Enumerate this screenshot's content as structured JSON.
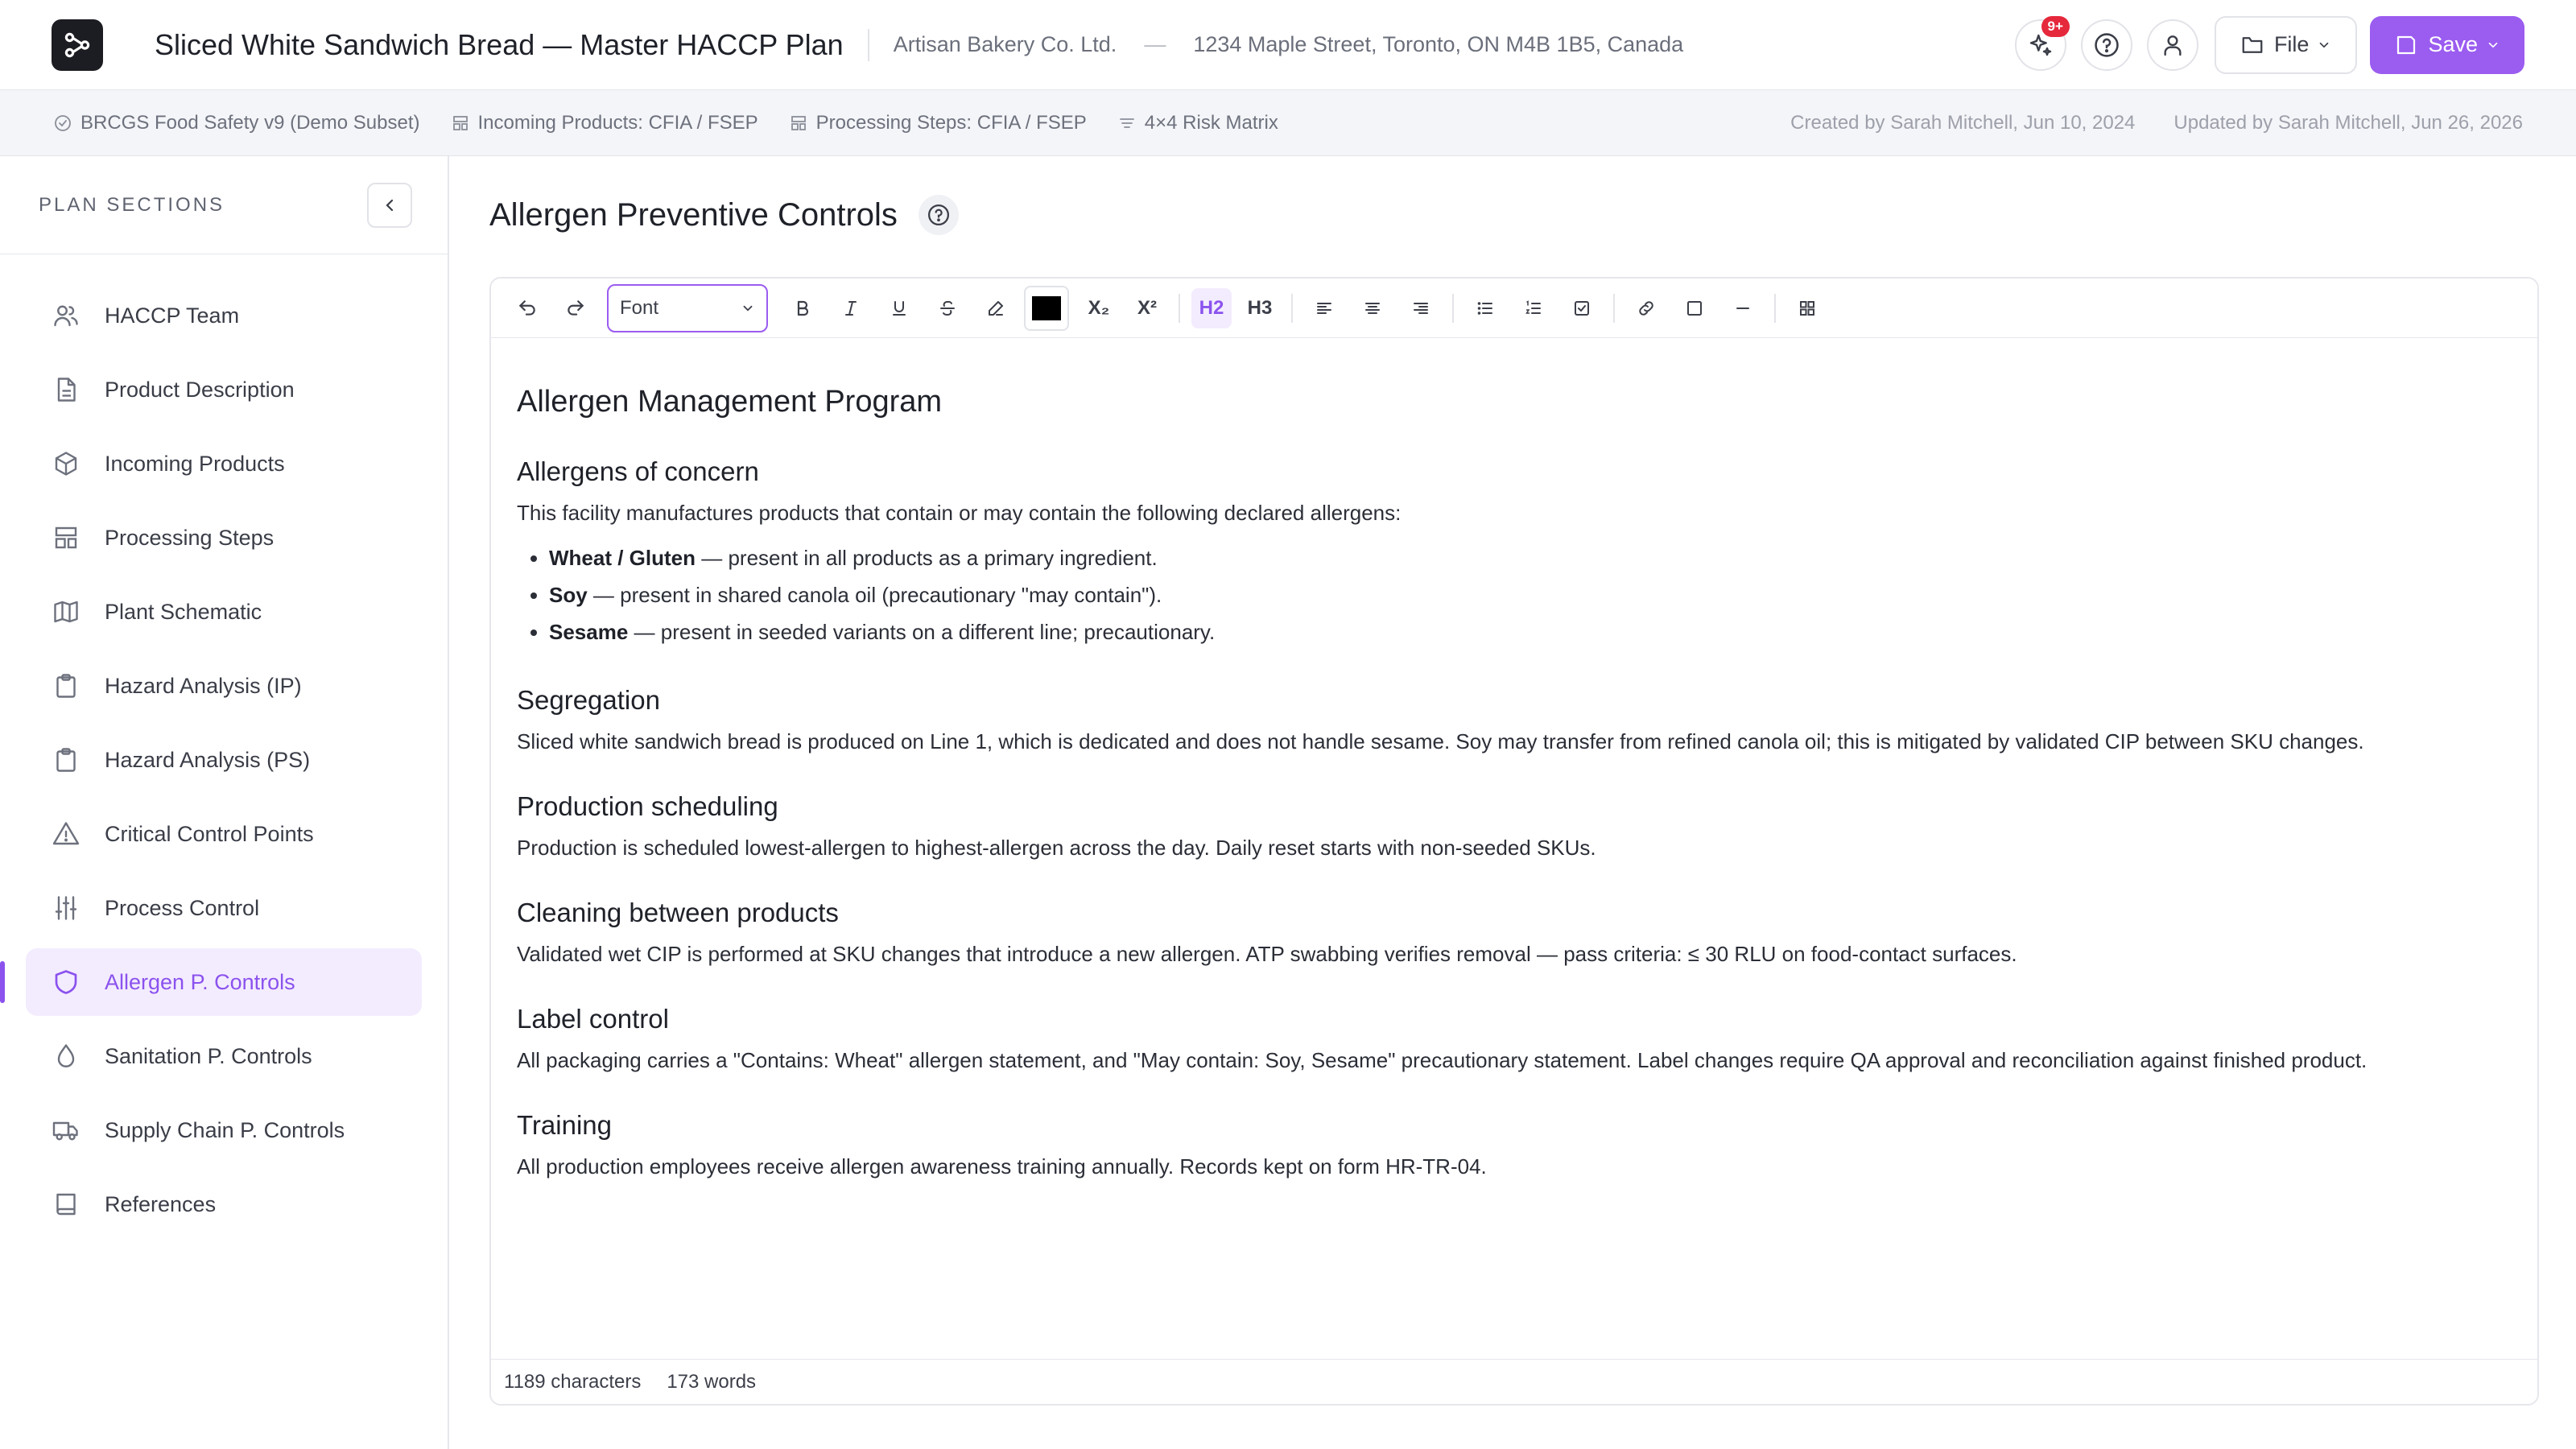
{
  "header": {
    "plan_title": "Sliced White Sandwich Bread — Master HACCP Plan",
    "company": "Artisan Bakery Co. Ltd.",
    "separator": "—",
    "address": "1234 Maple Street, Toronto, ON M4B 1B5, Canada",
    "notification_badge": "9+",
    "file_label": "File",
    "save_label": "Save",
    "accent_color": "#9b5cf0"
  },
  "meta": {
    "standard": "BRCGS Food Safety v9 (Demo Subset)",
    "incoming_products": "Incoming Products: CFIA / FSEP",
    "processing_steps": "Processing Steps: CFIA / FSEP",
    "risk_matrix": "4×4 Risk Matrix",
    "created": "Created by Sarah Mitchell, Jun 10, 2024",
    "updated": "Updated by Sarah Mitchell, Jun 26, 2026"
  },
  "sidebar": {
    "title": "PLAN SECTIONS",
    "items": [
      {
        "label": "HACCP Team",
        "icon": "users-icon"
      },
      {
        "label": "Product Description",
        "icon": "document-icon"
      },
      {
        "label": "Incoming Products",
        "icon": "box-icon"
      },
      {
        "label": "Processing Steps",
        "icon": "layout-icon"
      },
      {
        "label": "Plant Schematic",
        "icon": "map-icon"
      },
      {
        "label": "Hazard Analysis (IP)",
        "icon": "clipboard-icon"
      },
      {
        "label": "Hazard Analysis (PS)",
        "icon": "clipboard-icon"
      },
      {
        "label": "Critical Control Points",
        "icon": "warning-icon"
      },
      {
        "label": "Process Control",
        "icon": "sliders-icon"
      },
      {
        "label": "Allergen P. Controls",
        "icon": "shield-icon",
        "active": true
      },
      {
        "label": "Sanitation P. Controls",
        "icon": "droplet-icon"
      },
      {
        "label": "Supply Chain P. Controls",
        "icon": "truck-icon"
      },
      {
        "label": "References",
        "icon": "book-icon"
      }
    ]
  },
  "page": {
    "title": "Allergen Preventive Controls"
  },
  "toolbar": {
    "font_select": "Font",
    "subscript": "X₂",
    "superscript": "X²",
    "h2": "H2",
    "h3": "H3"
  },
  "document": {
    "title": "Allergen Management Program",
    "allergens_heading": "Allergens of concern",
    "allergens_intro": "This facility manufactures products that contain or may contain the following declared allergens:",
    "allergens": [
      {
        "name": "Wheat / Gluten",
        "text": " — present in all products as a primary ingredient."
      },
      {
        "name": "Soy",
        "text": " — present in shared canola oil (precautionary \"may contain\")."
      },
      {
        "name": "Sesame",
        "text": " — present in seeded variants on a different line; precautionary."
      }
    ],
    "segregation_heading": "Segregation",
    "segregation_text": "Sliced white sandwich bread is produced on Line 1, which is dedicated and does not handle sesame. Soy may transfer from refined canola oil; this is mitigated by validated CIP between SKU changes.",
    "scheduling_heading": "Production scheduling",
    "scheduling_text": "Production is scheduled lowest-allergen to highest-allergen across the day. Daily reset starts with non-seeded SKUs.",
    "cleaning_heading": "Cleaning between products",
    "cleaning_text": "Validated wet CIP is performed at SKU changes that introduce a new allergen. ATP swabbing verifies removal — pass criteria: ≤ 30 RLU on food-contact surfaces.",
    "label_heading": "Label control",
    "label_text": "All packaging carries a \"Contains: Wheat\" allergen statement, and \"May contain: Soy, Sesame\" precautionary statement. Label changes require QA approval and reconciliation against finished product.",
    "training_heading": "Training",
    "training_text": "All production employees receive allergen awareness training annually. Records kept on form HR-TR-04."
  },
  "status": {
    "characters": "1189 characters",
    "words": "173 words"
  }
}
